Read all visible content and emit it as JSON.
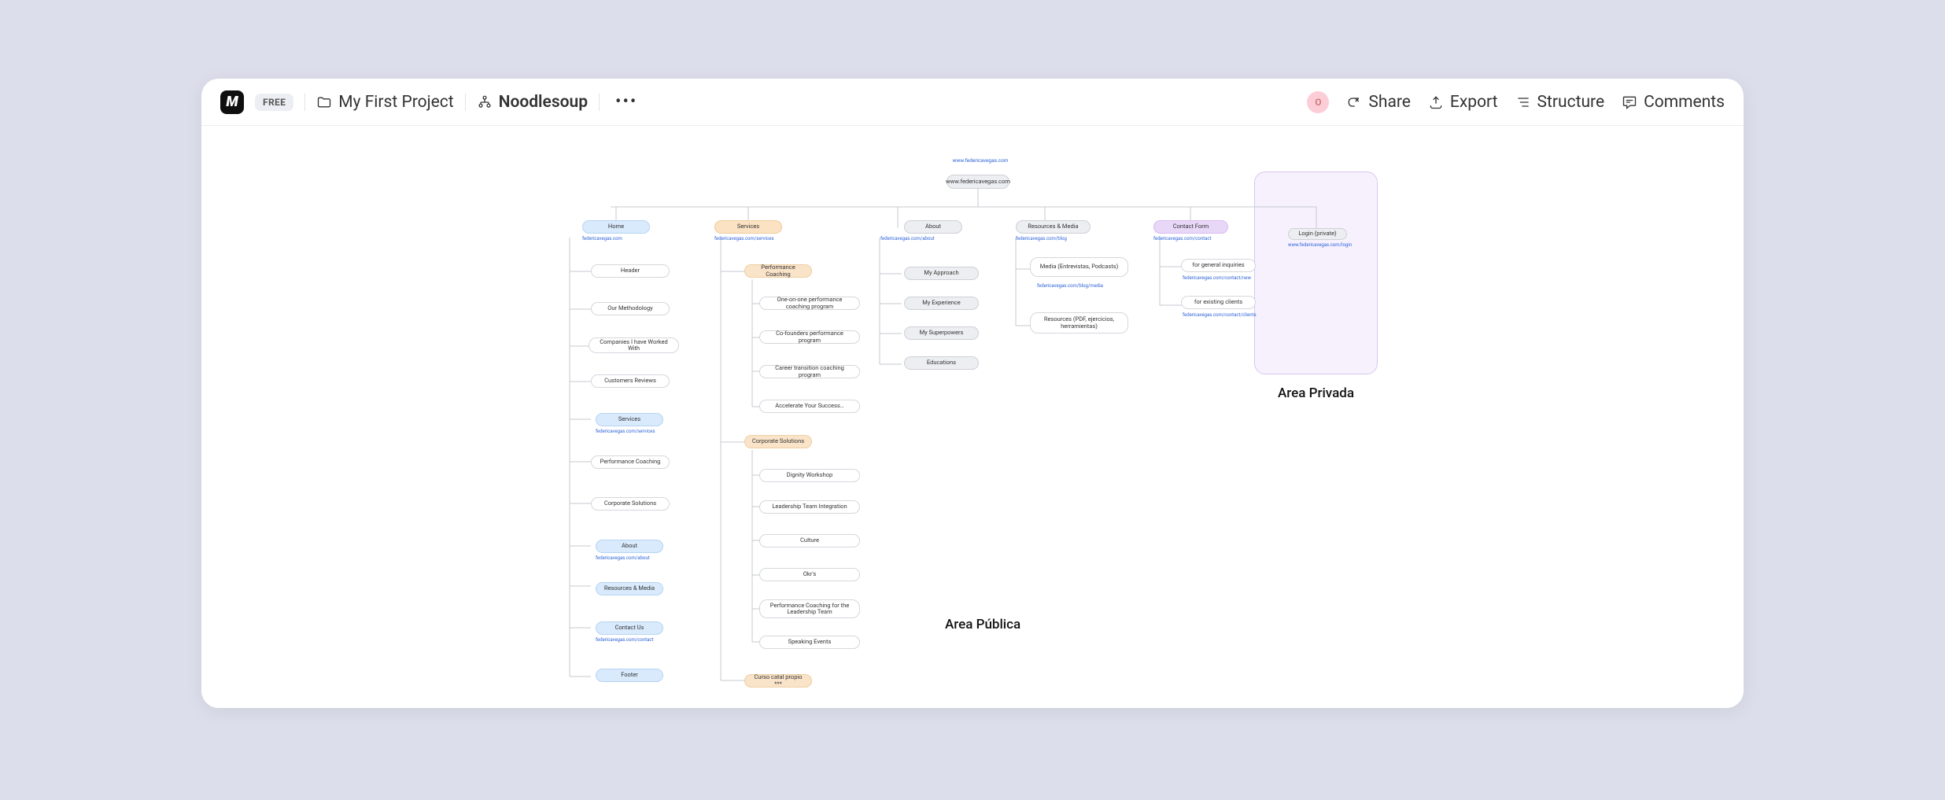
{
  "header": {
    "free_badge": "FREE",
    "project": "My First Project",
    "document": "Noodlesoup",
    "avatar_initial": "O",
    "share": "Share",
    "export": "Export",
    "structure": "Structure",
    "comments": "Comments"
  },
  "labels": {
    "area_publica": "Area Pública",
    "area_privada": "Area Privada"
  },
  "sitemap": {
    "root_url_top": "www.federicavegas.com",
    "root": "www.federicavegas.com",
    "columns": [
      {
        "top": {
          "label": "Home",
          "style": "blue",
          "url": "federicavegas.com"
        },
        "items": [
          {
            "label": "Header",
            "style": "white"
          },
          {
            "label": "Our Methodology",
            "style": "white"
          },
          {
            "label": "Companies I have Worked With",
            "style": "white"
          },
          {
            "label": "Customers Reviews",
            "style": "white"
          },
          {
            "label": "Services",
            "style": "blue",
            "url": "federicavegas.com/services"
          },
          {
            "label": "Performance Coaching",
            "style": "white"
          },
          {
            "label": "Corporate Solutions",
            "style": "white"
          },
          {
            "label": "About",
            "style": "blue",
            "url": "federicavegas.com/about"
          },
          {
            "label": "Resources & Media",
            "style": "blue"
          },
          {
            "label": "Contact Us",
            "style": "blue",
            "url": "federicavegas.com/contact"
          },
          {
            "label": "Footer",
            "style": "blue"
          }
        ]
      },
      {
        "top": {
          "label": "Services",
          "style": "orange",
          "url": "federicavegas.com/services"
        },
        "groups": [
          {
            "head": {
              "label": "Performance Coaching",
              "style": "orange2"
            },
            "children": [
              "One-on-one performance coaching program",
              "Co-founders performance program",
              "Career transition coaching program",
              "Accelerate Your Success…"
            ]
          },
          {
            "head": {
              "label": "Corporate Solutions",
              "style": "orange2"
            },
            "children": [
              "Dignity Workshop",
              "Leadership Team Integration",
              "Culture",
              "Okr's",
              "Performance Coaching for the Leadership Team",
              "Speaking Events"
            ]
          },
          {
            "head": {
              "label": "Curso catal propio ***",
              "style": "orange2"
            }
          }
        ]
      },
      {
        "top": {
          "label": "About",
          "style": "grey",
          "url": "federicavegas.com/about"
        },
        "items": [
          {
            "label": "My Approach",
            "style": "grey"
          },
          {
            "label": "My Experience",
            "style": "grey"
          },
          {
            "label": "My Superpowers",
            "style": "grey"
          },
          {
            "label": "Educations",
            "style": "grey"
          }
        ]
      },
      {
        "top": {
          "label": "Resources & Media",
          "style": "grey",
          "url": "federicavegas.com/blog"
        },
        "items": [
          {
            "label": "Media (Entrevistas, Podcasts)",
            "style": "white",
            "url": "federicavegas.com/blog/media"
          },
          {
            "label": "Resources (PDF, ejercicios, herramientas)",
            "style": "white"
          }
        ]
      },
      {
        "top": {
          "label": "Contact Form",
          "style": "purple",
          "url": "federicavegas.com/contact"
        },
        "items": [
          {
            "label": "for general inquiries",
            "style": "white",
            "url": "federicavegas.com/contact/new"
          },
          {
            "label": "for existing clients",
            "style": "white",
            "url": "federicavegas.com/contact/clients"
          }
        ]
      },
      {
        "top": {
          "label": "Login (private)",
          "style": "grey",
          "url": "www.federicavegas.com/login"
        }
      }
    ]
  }
}
